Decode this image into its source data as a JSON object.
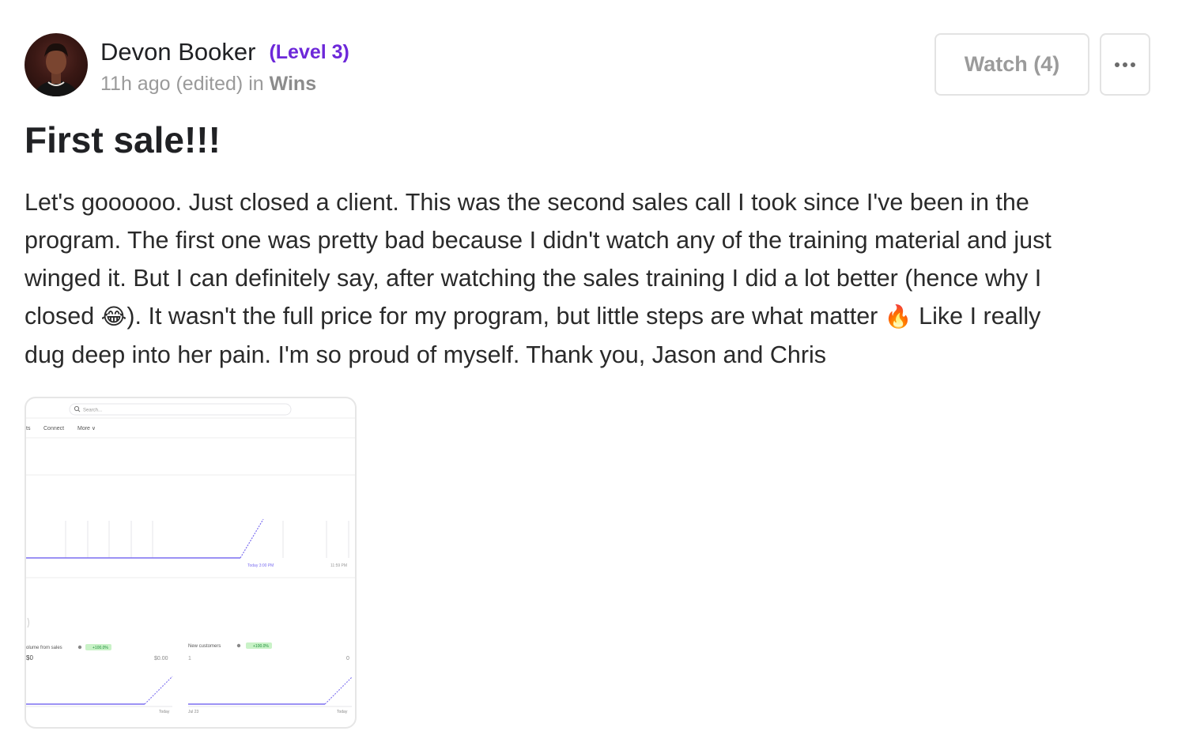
{
  "author": {
    "name": "Devon Booker",
    "level": "(Level 3)"
  },
  "meta": {
    "time": "11h ago (edited)",
    "in_word": "in",
    "category": "Wins"
  },
  "actions": {
    "watch_label": "Watch (4)",
    "more_icon": "ellipsis-icon"
  },
  "post": {
    "title": "First sale!!!",
    "body_lines": [
      "Let's goooooo. Just closed a client. This was the second sales call I took since I've been in the",
      "program. The first one was pretty bad because I didn't watch any of the training material and just",
      "winged it. But I can definitely say, after watching the sales training I did a lot better (hence why I"
    ],
    "line4_before_emoji": "closed ",
    "laugh_emoji": "😂",
    "line4_middle": "). It wasn't the full price for my program, but little steps are what matter ",
    "fire_emoji": "🔥",
    "line4_after": " Like I really",
    "line5": "dug deep into her pain. I'm so proud of myself. Thank you, Jason and Chris"
  },
  "attachment": {
    "search_placeholder": "Search...",
    "tabs": [
      "ts",
      "Connect",
      "More ∨"
    ],
    "main_chart_time_label": "Today 3:00 PM",
    "main_chart_end_label": "11:59 PM",
    "card1_label": "olume from sales",
    "card1_badge": "+100.0%",
    "card1_value": "$0",
    "card1_prev": "$0.00",
    "card1_x_end": "Today",
    "card2_label": "New customers",
    "card2_badge": "+100.0%",
    "card2_value": "1",
    "card2_prev": "0",
    "card2_x_start": "Jul 23",
    "card2_x_end": "Today",
    "accent_color": "#7c6ff0",
    "badge_color": "#c9f2c7"
  }
}
